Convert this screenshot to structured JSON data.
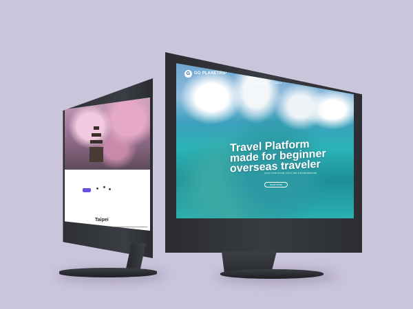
{
  "left_screen": {
    "search_label": "",
    "city_title": "Taipei"
  },
  "right_screen": {
    "logo_mark": "G",
    "logo_text": "GO PLANETRIP",
    "nav": [
      "HOW TO USE",
      "TRAVEL",
      "MY PAGE"
    ],
    "hero_title": "Travel Platform made for beginner overseas traveler",
    "hero_subtitle": "CLICK YOUR PLACE, YOU'LL GET THE INFORMATION",
    "cta_label": "READ MORE"
  },
  "colors": {
    "background": "#cbc5dc",
    "monitor": "#2f3136",
    "accent": "#6d4fe0"
  }
}
